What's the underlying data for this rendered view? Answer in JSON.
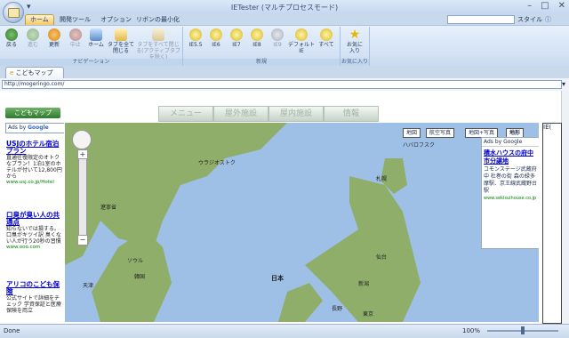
{
  "window": {
    "title": "IETester (マルチプロセスモード)"
  },
  "ribbon_tabs": [
    {
      "label": "ホーム",
      "active": true
    },
    {
      "label": "開発ツール",
      "active": false
    },
    {
      "label": "オプション",
      "active": false
    },
    {
      "label": "リボンの最小化",
      "active": false
    }
  ],
  "ribbon_search": {
    "label": "スタイル"
  },
  "nav_group": {
    "label": "ナビゲーション",
    "buttons": [
      "戻る",
      "進む",
      "更新",
      "中止",
      "ホーム",
      "タブを全て閉じる",
      "タブをすべて閉じる(アクティブタブを除く)"
    ]
  },
  "new_group": {
    "label": "新規",
    "buttons": [
      "IE5.5",
      "IE6",
      "IE7",
      "IE8",
      "IE9",
      "デフォルトIE",
      "すべて"
    ]
  },
  "fav_group": {
    "label": "お気に入り",
    "button": "お気に入り"
  },
  "doc_tab": {
    "label": "こどもマップ"
  },
  "address": {
    "value": "http://mogeringo.com/"
  },
  "page": {
    "kodomo_button": "こどもマップ",
    "nav_buttons": [
      "メニュー",
      "屋外施設",
      "屋内施設",
      "情報"
    ],
    "ads_label": "Ads by",
    "ads_brand": "Google",
    "ads": [
      {
        "title": "USJのホテル宿泊プラン",
        "desc": "直通往復限定のオトクなプラン！1泊1室のホテルが付いて12,800円から",
        "url": "www.usj.co.jp/Hotel"
      },
      {
        "title": "口臭が臭い人の共通点",
        "desc": "知らないでは損する。口臭がキツイ訳 臭くない人が行う20秒の習慣",
        "url": "www.ooo.com"
      },
      {
        "title": "アリコのこども保険",
        "desc": "公式サイトで詳細をチェック 学資保証と医療保険を両立",
        "url": ""
      }
    ]
  },
  "map": {
    "controls": [
      "地図",
      "航空写真",
      "地図+写真",
      "地形"
    ],
    "active_control": "地形",
    "labels": [
      "日本",
      "韓国",
      "仙台",
      "新潟",
      "東京",
      "札幌",
      "長野",
      "ソウル",
      "遼寧省",
      "天津",
      "ハバロフスク",
      "ウラジオストク"
    ],
    "ad": {
      "ads_label": "Ads by Google",
      "title": "積水ハウスの府中市分譲地",
      "desc": "コモンステージ武蔵府中 杜巻の街 森の緑多摩駅、京王線武蔵野台駅",
      "url": "www.sekisuihouse.co.jp"
    }
  },
  "right_panel": {
    "text": "IE("
  },
  "statusbar": {
    "status": "Done",
    "zoom": "100%"
  },
  "colors": {
    "ribbon_accent": "#f5c865",
    "map_sea": "#9fc0e6",
    "map_land": "#8fae6a"
  }
}
